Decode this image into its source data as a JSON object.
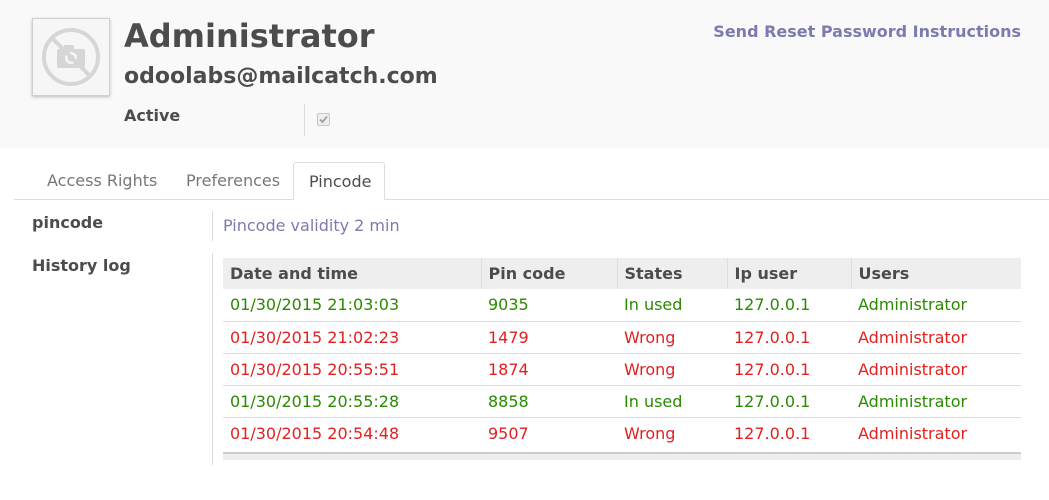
{
  "user": {
    "name": "Administrator",
    "email": "odoolabs@mailcatch.com",
    "active_label": "Active",
    "active_checked": true
  },
  "actions": {
    "reset_password": "Send Reset Password Instructions"
  },
  "tabs": [
    {
      "label": "Access Rights",
      "active": false
    },
    {
      "label": "Preferences",
      "active": false
    },
    {
      "label": "Pincode",
      "active": true
    }
  ],
  "pincode": {
    "label": "pincode",
    "value": "Pincode validity 2 min"
  },
  "history": {
    "label": "History log",
    "columns": [
      "Date and time",
      "Pin code",
      "States",
      "Ip user",
      "Users"
    ],
    "rows": [
      {
        "date": "01/30/2015 21:03:03",
        "pin": "9035",
        "state": "In used",
        "ip": "127.0.0.1",
        "user": "Administrator"
      },
      {
        "date": "01/30/2015 21:02:23",
        "pin": "1479",
        "state": "Wrong",
        "ip": "127.0.0.1",
        "user": "Administrator"
      },
      {
        "date": "01/30/2015 20:55:51",
        "pin": "1874",
        "state": "Wrong",
        "ip": "127.0.0.1",
        "user": "Administrator"
      },
      {
        "date": "01/30/2015 20:55:28",
        "pin": "8858",
        "state": "In used",
        "ip": "127.0.0.1",
        "user": "Administrator"
      },
      {
        "date": "01/30/2015 20:54:48",
        "pin": "9507",
        "state": "Wrong",
        "ip": "127.0.0.1",
        "user": "Administrator"
      }
    ]
  },
  "colors": {
    "link": "#7c7bad",
    "in_used": "#2a8a00",
    "wrong": "#e41f1f"
  },
  "icons": {
    "avatar": "no-photo-camera-icon",
    "checkbox": "checkmark-icon"
  }
}
